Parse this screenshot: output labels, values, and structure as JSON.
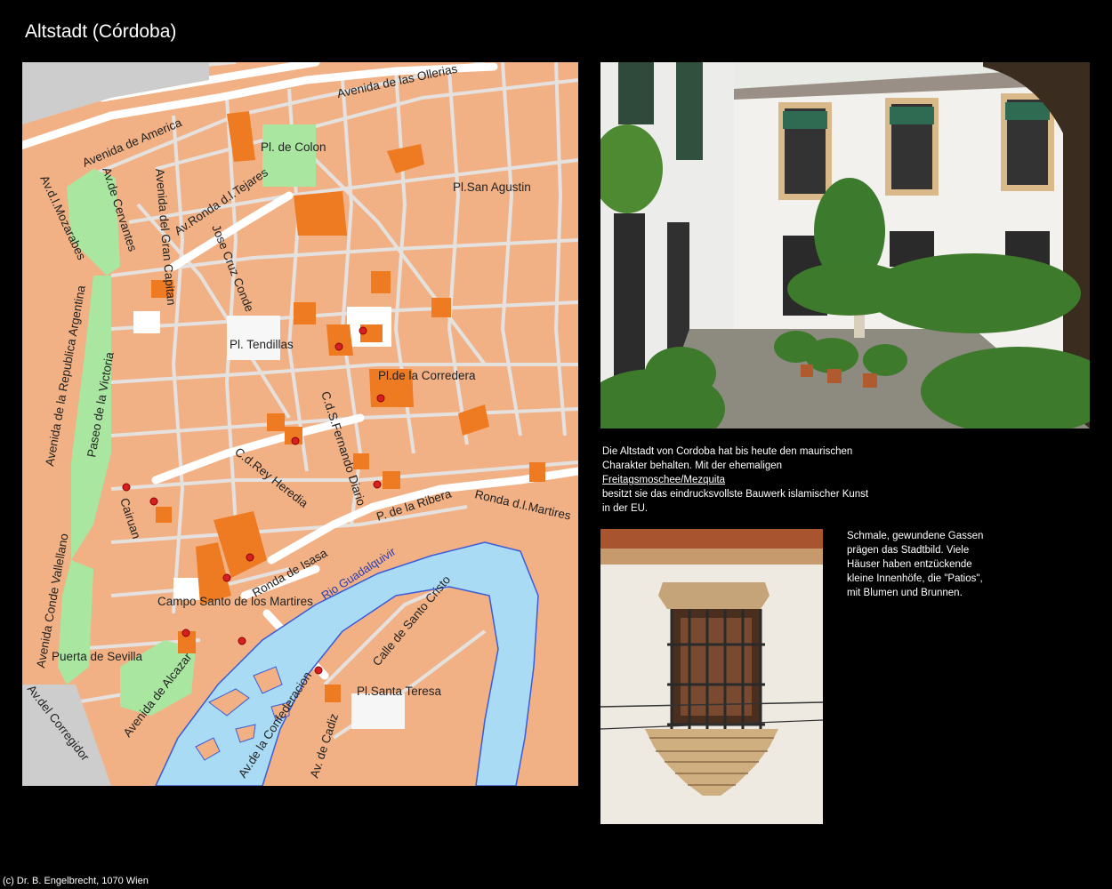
{
  "page": {
    "title": "Altstadt (Córdoba)",
    "copyright": "(c) Dr. B. Engelbrecht, 1070 Wien"
  },
  "map": {
    "streets": [
      "Avenida de las Ollerias",
      "Avenida de America",
      "Pl. de Colon",
      "Pl.San Agustin",
      "Av.d.l.Mozarabes",
      "Av.de Cervantes",
      "Avenida del Gran Capitan",
      "Av.Ronda d.l.Tejares",
      "Jose Cruz Conde",
      "Avenida de la Republica Argentina",
      "Paseo de la Victoria",
      "Pl. Tendillas",
      "Pl.de la Corredera",
      "C.d.S.Fernando Diario",
      "C.d.Rey Heredia",
      "P. de la Ribera",
      "Ronda d.l.Martires",
      "Cairuan",
      "Ronda de Isasa",
      "Rio Guadalquivir",
      "Campo Santo de los Martires",
      "Avenida Conde Vallellano",
      "Puerta de Sevilla",
      "Avenida de Alcazar",
      "Calle de Santo Cristo",
      "Av.del Corregidor",
      "Pl.Santa Teresa",
      "Av.de la Confederacion",
      "Av. de Cadiz"
    ]
  },
  "captions": {
    "c1_line1": "Die Altstadt von Cordoba hat bis heute den maurischen",
    "c1_line2": "Charakter behalten. Mit der ehemaligen",
    "c1_link": "Freitagsmoschee/Mezquita",
    "c1_line3": "besitzt sie das eindrucksvollste Bauwerk islamischer Kunst",
    "c1_line4": "in der EU.",
    "c2_line1": "Schmale, gewundene Gassen",
    "c2_line2": "prägen das Stadtbild. Viele",
    "c2_line3": "Häuser haben entzückende",
    "c2_line4": "kleine Innenhöfe, die \"Patios\",",
    "c2_line5": "mit Blumen und Brunnen."
  },
  "colors": {
    "background": "#000000",
    "map_block": "#f2b185",
    "map_highlight": "#ee7a22",
    "map_park": "#a9e6a0",
    "river": "#a9dcf4",
    "river_shore": "#3b5bd9"
  }
}
